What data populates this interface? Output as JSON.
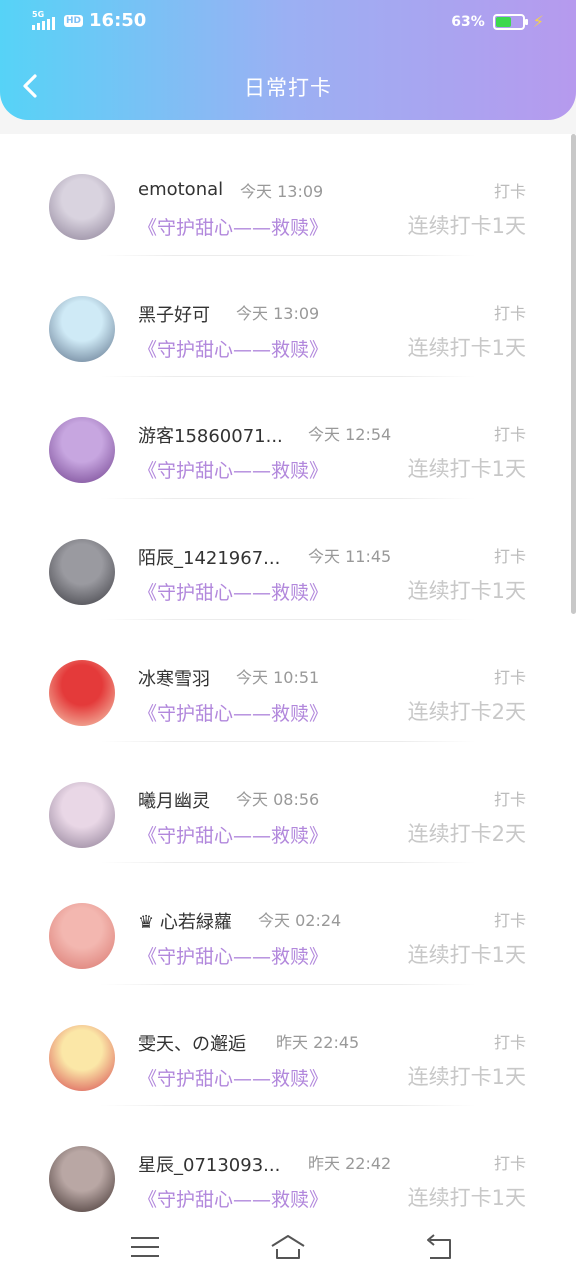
{
  "status_bar": {
    "network": "5G",
    "hd": "HD",
    "time": "16:50",
    "battery_percent": "63%",
    "battery_level": 0.63,
    "battery_color": "#3cd84e"
  },
  "header": {
    "title": "日常打卡",
    "gradient": [
      "#56d3f7",
      "#b69aee"
    ]
  },
  "entries": [
    {
      "name": "emotonal",
      "time": "今天 13:09",
      "tag": "打卡",
      "book": "《守护甜心——救赎》",
      "streak": "连续打卡1天",
      "avatar_colors": [
        "#d9d3df",
        "#8a7e95"
      ]
    },
    {
      "name": "黑子好可",
      "time": "今天 13:09",
      "tag": "打卡",
      "book": "《守护甜心——救赎》",
      "streak": "连续打卡1天",
      "avatar_colors": [
        "#cfeaf6",
        "#5a6e87"
      ]
    },
    {
      "name": "游客15860071...",
      "time": "今天 12:54",
      "tag": "打卡",
      "book": "《守护甜心——救赎》",
      "streak": "连续打卡1天",
      "avatar_colors": [
        "#c7a6e0",
        "#6f3f8c"
      ]
    },
    {
      "name": "陌辰_1421967...",
      "time": "今天 11:45",
      "tag": "打卡",
      "book": "《守护甜心——救赎》",
      "streak": "连续打卡1天",
      "avatar_colors": [
        "#9a9aa0",
        "#3a3a40"
      ]
    },
    {
      "name": "冰寒雪羽",
      "time": "今天 10:51",
      "tag": "打卡",
      "book": "《守护甜心——救赎》",
      "streak": "连续打卡2天",
      "avatar_colors": [
        "#e43a3a",
        "#f6d2b8"
      ]
    },
    {
      "name": "曦月幽灵",
      "time": "今天 08:56",
      "tag": "打卡",
      "book": "《守护甜心——救赎》",
      "streak": "连续打卡2天",
      "avatar_colors": [
        "#e9d7e6",
        "#8b7b93"
      ]
    },
    {
      "name": "♛ 心若緑蘿",
      "time": "今天 02:24",
      "tag": "打卡",
      "book": "《守护甜心——救赎》",
      "streak": "连续打卡1天",
      "avatar_colors": [
        "#f3b7b0",
        "#d9766e"
      ]
    },
    {
      "name": "雯天、の邂逅",
      "time": "昨天 22:45",
      "tag": "打卡",
      "book": "《守护甜心——救赎》",
      "streak": "连续打卡1天",
      "avatar_colors": [
        "#fbe7a7",
        "#d6464e"
      ]
    },
    {
      "name": "星辰_0713093...",
      "time": "昨天 22:42",
      "tag": "打卡",
      "book": "《守护甜心——救赎》",
      "streak": "连续打卡1天",
      "avatar_colors": [
        "#b9a7a4",
        "#3b2d2b"
      ]
    }
  ],
  "nav": {
    "menu_icon": "menu-icon",
    "home_icon": "home-icon",
    "back_icon": "return-icon"
  }
}
